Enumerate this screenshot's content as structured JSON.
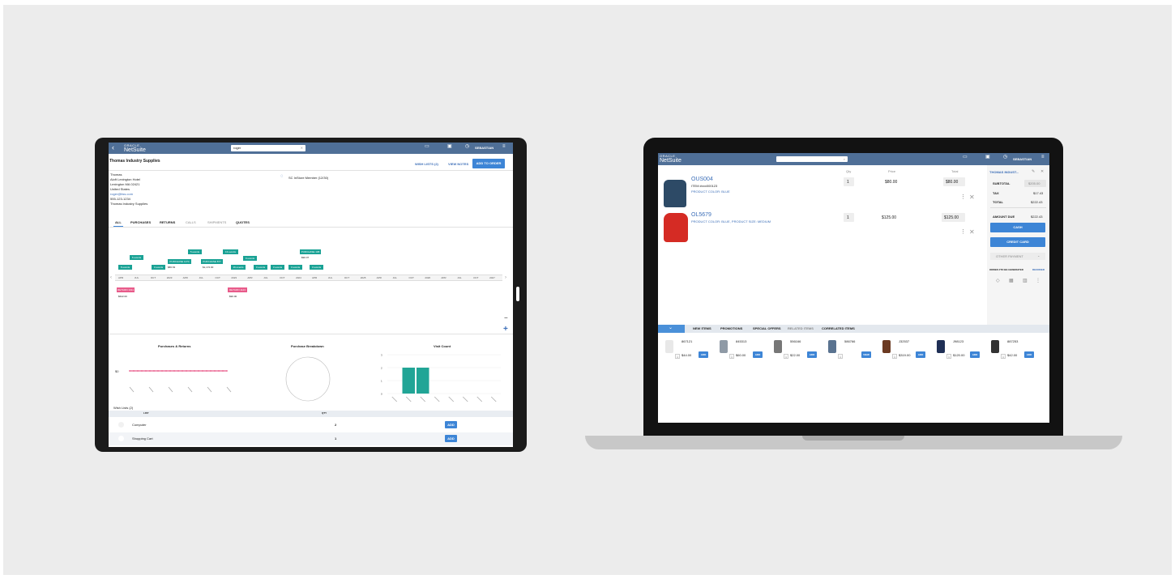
{
  "tablet": {
    "brand": {
      "top": "ORACLE",
      "name": "NetSuite"
    },
    "search_value": "roger",
    "user": "SEBASTIAN",
    "customer_name": "Thomas Industry Supplies",
    "wish_lists_link": "WISH LISTS (2)",
    "view_notes_link": "VIEW NOTES",
    "add_to_order": "ADD TO ORDER",
    "address_lines": [
      "Thomas",
      "Aloft Lexington Hotel",
      "Lexington MA 02421",
      "United States",
      "roger@tiss.com",
      "555-123-1234",
      "Thomas Industry Supplies"
    ],
    "member_status": "SC InStore Member (12/30)",
    "tabs": [
      "ALL",
      "PURCHASES",
      "RETURNS",
      "CALLS",
      "SHIPMENTS",
      "QUOTES"
    ],
    "timeline_axis": [
      "APR",
      "JUL",
      "OCT",
      "2023",
      "APR",
      "JUL",
      "OCT",
      "2023",
      "APR",
      "JUL",
      "OCT",
      "2024",
      "APR",
      "JUL",
      "OCT",
      "2025",
      "APR",
      "JUL",
      "OCT",
      "2026",
      "APR",
      "JUL",
      "OCT",
      "2027"
    ],
    "timeline_chips": [
      "6 events",
      "8 events",
      "5 events",
      "13 events",
      "9 events",
      "PURCHASE 108",
      "3 events",
      "16 events",
      "PURCHASE 1274",
      "PURCHASE 877",
      "3 events",
      "3 events",
      "3 events",
      "3 events",
      "3 events"
    ],
    "timeline_amounts": [
      "$86.63",
      "$1,172.00",
      "$90.07"
    ],
    "returns": [
      {
        "label": "RETURN 1011",
        "amount": "$622.00"
      },
      {
        "label": "RETURN 1123",
        "amount": "$90.00"
      }
    ],
    "zoom": {
      "minus": "−",
      "plus": "+"
    },
    "chart_titles": [
      "Purchases & Returns",
      "Purchase Breakdown",
      "Visit Count"
    ],
    "wish_lists_title": "Wish Lists (2)",
    "wish_table": {
      "headers": [
        "LIST",
        "QTY"
      ],
      "rows": [
        {
          "name": "Computer",
          "qty": "2",
          "action": "ADD"
        },
        {
          "name": "Shopping Cart",
          "qty": "1",
          "action": "ADD"
        }
      ]
    }
  },
  "chart_data": [
    {
      "type": "line",
      "title": "Purchases & Returns",
      "series": [
        {
          "values": [
            1,
            1,
            1,
            1,
            1,
            1,
            1,
            1,
            1,
            1,
            1,
            1,
            1,
            1,
            1,
            1,
            1,
            1,
            1,
            1,
            1,
            1,
            1,
            1,
            1
          ]
        }
      ],
      "ylabel_tick": "$0"
    },
    {
      "type": "pie",
      "title": "Purchase Breakdown",
      "values": []
    },
    {
      "type": "bar",
      "title": "Visit Count",
      "categories": [
        "1",
        "2",
        "3",
        "4",
        "5",
        "6",
        "7",
        "8"
      ],
      "values": [
        0,
        2,
        2,
        0,
        0,
        0,
        0,
        0
      ],
      "ylim": [
        0,
        3
      ]
    }
  ],
  "laptop": {
    "brand": {
      "top": "ORACLE",
      "name": "NetSuite"
    },
    "user": "SEBASTIAN",
    "col_headers": [
      "Qty",
      "Price",
      "Total"
    ],
    "items": [
      {
        "sku": "OUS004",
        "sub": "ITEM #xxx000123",
        "opt": "PRODUCT COLOR: BLUE",
        "qty": "1",
        "price": "$80.00",
        "total": "$80.00"
      },
      {
        "sku": "OL5679",
        "sub": "",
        "opt": "PRODUCT COLOR: BLUE, PRODUCT SIZE: MEDIUM",
        "qty": "1",
        "price": "$125.00",
        "total": "$125.00"
      }
    ],
    "summary": {
      "customer": "THOMAS INDUST...",
      "subtotal_label": "SUBTOTAL",
      "subtotal": "$205.00",
      "tax_label": "TAX",
      "tax": "$17.43",
      "total_label": "TOTAL",
      "total": "$222.43",
      "amount_due_label": "AMOUNT DUE",
      "amount_due": "$222.43",
      "cash": "CASH",
      "credit": "CREDIT CARD",
      "other": "OTHER PAYMENT",
      "order_note": "ORDER #TO BE GENERATED",
      "reorder": "REORDER"
    },
    "bottom_tabs": [
      "NEW ITEMS",
      "PROMOTIONS",
      "SPECIAL OFFERS",
      "RELATED ITEMS",
      "CORRELATED ITEMS"
    ],
    "products": [
      {
        "sku": "867121",
        "price": "$44.00",
        "btn": "ADD"
      },
      {
        "sku": "845313",
        "price": "$60.00",
        "btn": "ADD"
      },
      {
        "sku": "556166",
        "price": "$22.00",
        "btn": "ADD"
      },
      {
        "sku": "586766",
        "price": "",
        "btn": "VIEW"
      },
      {
        "sku": "J32537",
        "price": "$319.00",
        "btn": "ADD"
      },
      {
        "sku": "J98123",
        "price": "$120.00",
        "btn": "ADD"
      },
      {
        "sku": "887253",
        "price": "$42.00",
        "btn": "ADD"
      }
    ]
  }
}
